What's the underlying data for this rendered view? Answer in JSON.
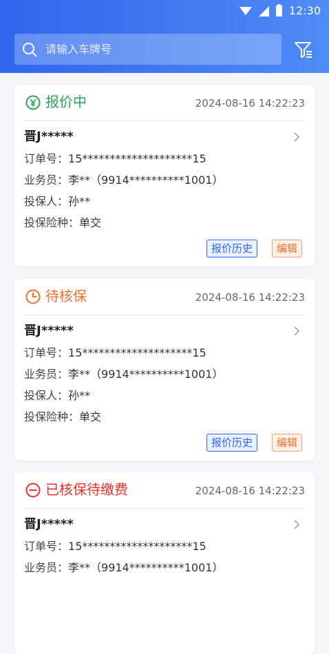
{
  "status_bar": {
    "time": "12:30"
  },
  "search": {
    "placeholder": "请输入车牌号"
  },
  "labels": {
    "order_no": "订单号：",
    "salesman": "业务员：",
    "insured": "投保人：",
    "insurance_type": "投保险种："
  },
  "buttons": {
    "history": "报价历史",
    "edit": "编辑"
  },
  "colors": {
    "quoting": "#27a35a",
    "pending_review": "#f0702c",
    "pending_payment": "#e8302a",
    "primary": "#2f67ee"
  },
  "orders": [
    {
      "status": "报价中",
      "status_icon": "yen-circle-icon",
      "time": "2024-08-16 14:22:23",
      "plate": "晋J*****",
      "order_no": "15********************15",
      "salesman": "李**（9914**********1001）",
      "insured": "孙**",
      "insurance_type": "单交"
    },
    {
      "status": "待核保",
      "status_icon": "clock-icon",
      "time": "2024-08-16 14:22:23",
      "plate": "晋J*****",
      "order_no": "15********************15",
      "salesman": "李**（9914**********1001）",
      "insured": "孙**",
      "insurance_type": "单交"
    },
    {
      "status": "已核保待缴费",
      "status_icon": "minus-circle-icon",
      "time": "2024-08-16 14:22:23",
      "plate": "晋J*****",
      "order_no": "15********************15",
      "salesman": "李**（9914**********1001）"
    }
  ]
}
